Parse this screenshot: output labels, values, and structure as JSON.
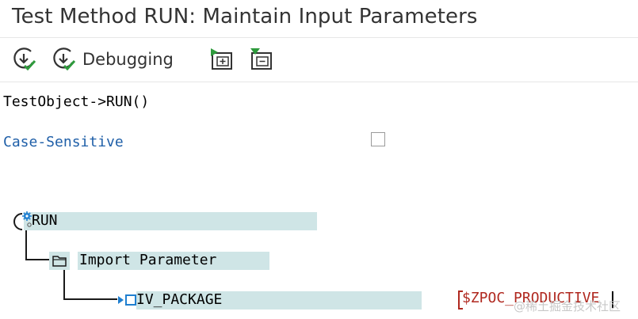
{
  "window": {
    "title": "Test Method RUN: Maintain Input Parameters"
  },
  "toolbar": {
    "buttons": [
      {
        "icon": "execute-icon",
        "label": ""
      },
      {
        "icon": "debug-execute-icon",
        "label": "Debugging"
      },
      {
        "icon": "expand-all-icon",
        "label": ""
      },
      {
        "icon": "collapse-all-icon",
        "label": ""
      }
    ]
  },
  "method": {
    "signature": "TestObject->RUN()"
  },
  "options": {
    "case_sensitive_label": "Case-Sensitive",
    "case_sensitive_checked": false
  },
  "tree": {
    "root": {
      "label": "RUN",
      "icon": "method-gear-icon"
    },
    "group": {
      "label": "Import Parameter",
      "icon": "folder-icon"
    },
    "param": {
      "label": "IV_PACKAGE",
      "value": "$ZPOC_PRODUCTIVE"
    }
  },
  "watermark": "@稀土掘金技术社区",
  "colors": {
    "accent_blue": "#1f5fa8",
    "value_red": "#b0281f",
    "tree_highlight": "#cfe5e6",
    "check_green": "#2e9a3c"
  }
}
